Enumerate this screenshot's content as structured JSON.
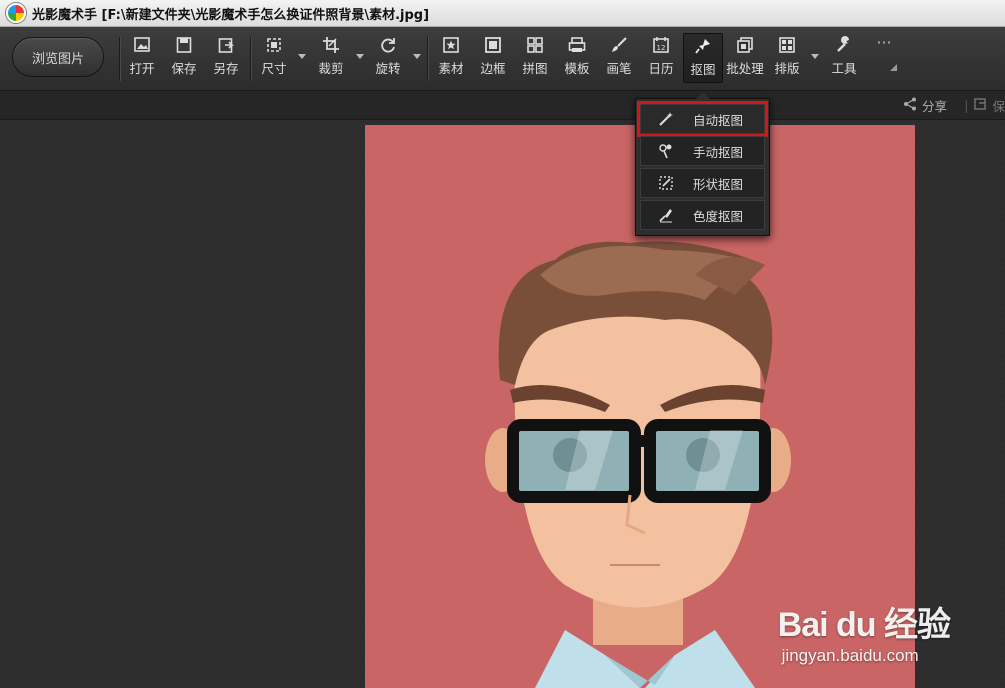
{
  "window": {
    "title": "光影魔术手 [F:\\新建文件夹\\光影魔术手怎么换证件照背景\\素材.jpg]"
  },
  "toolbar": {
    "browse_label": "浏览图片",
    "tools": [
      {
        "label": "打开",
        "icon": "open-image-icon"
      },
      {
        "label": "保存",
        "icon": "save-icon"
      },
      {
        "label": "另存",
        "icon": "save-as-icon"
      },
      {
        "label": "尺寸",
        "icon": "resize-icon"
      },
      {
        "label": "裁剪",
        "icon": "crop-icon"
      },
      {
        "label": "旋转",
        "icon": "rotate-icon"
      },
      {
        "label": "素材",
        "icon": "material-icon"
      },
      {
        "label": "边框",
        "icon": "border-icon"
      },
      {
        "label": "拼图",
        "icon": "collage-icon"
      },
      {
        "label": "模板",
        "icon": "template-icon"
      },
      {
        "label": "画笔",
        "icon": "brush-icon"
      },
      {
        "label": "日历",
        "icon": "calendar-icon"
      },
      {
        "label": "抠图",
        "icon": "cutout-icon"
      },
      {
        "label": "批处理",
        "icon": "batch-icon"
      },
      {
        "label": "排版",
        "icon": "layout-icon"
      },
      {
        "label": "工具",
        "icon": "wrench-icon"
      }
    ],
    "more_label": "···",
    "active_tool": "抠图",
    "calendar_day": "12"
  },
  "subbar": {
    "share_label": "分享",
    "save_label": "保"
  },
  "cutout_menu": {
    "items": [
      {
        "label": "自动抠图",
        "icon": "magic-wand-icon",
        "highlighted": true
      },
      {
        "label": "手动抠图",
        "icon": "manual-cutout-icon",
        "highlighted": false
      },
      {
        "label": "形状抠图",
        "icon": "shape-cutout-icon",
        "highlighted": false
      },
      {
        "label": "色度抠图",
        "icon": "chroma-cutout-icon",
        "highlighted": false
      }
    ]
  },
  "watermark": {
    "logo_text": "Bai du 经验",
    "url": "jingyan.baidu.com"
  },
  "colors": {
    "photo_background": "#c96565",
    "highlight_outline": "#d01818",
    "toolbar_bg": "#333333"
  }
}
